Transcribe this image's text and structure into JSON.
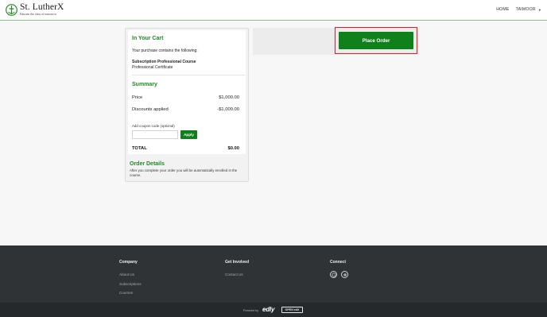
{
  "brand": {
    "name": "St. LutherX",
    "tagline": "Educate the class of tomorrow",
    "accent": "#1e8a24"
  },
  "nav": {
    "home": "HOME",
    "user": "TAIMOOR"
  },
  "cart": {
    "title": "In Your Cart",
    "description": "Your purchase contains the following:",
    "course_name": "Subscription Professional Course",
    "course_type": "Professional Certificate"
  },
  "summary": {
    "title": "Summary",
    "price_label": "Price",
    "price_value": "$1,000.00",
    "discount_label": "Discounts applied",
    "discount_value": "-$1,000.00",
    "coupon_label": "Add coupon code (optional)",
    "coupon_value": "",
    "apply_label": "Apply",
    "total_label": "TOTAL",
    "total_value": "$0.00"
  },
  "order_details": {
    "title": "Order Details",
    "text": "After you complete your order you will be automatically enrolled in the course."
  },
  "place_order": {
    "label": "Place Order"
  },
  "footer": {
    "company_title": "Company",
    "company_links": [
      "About Us",
      "Subscriptions",
      "Courses"
    ],
    "involved_title": "Get Involved",
    "involved_links": [
      "Contact Us"
    ],
    "connect_title": "Connect",
    "social_icons": [
      "chat-icon",
      "settings-icon"
    ],
    "powered_by": "Powered by",
    "edly": "edly",
    "open_edx": "OPEN edX"
  }
}
